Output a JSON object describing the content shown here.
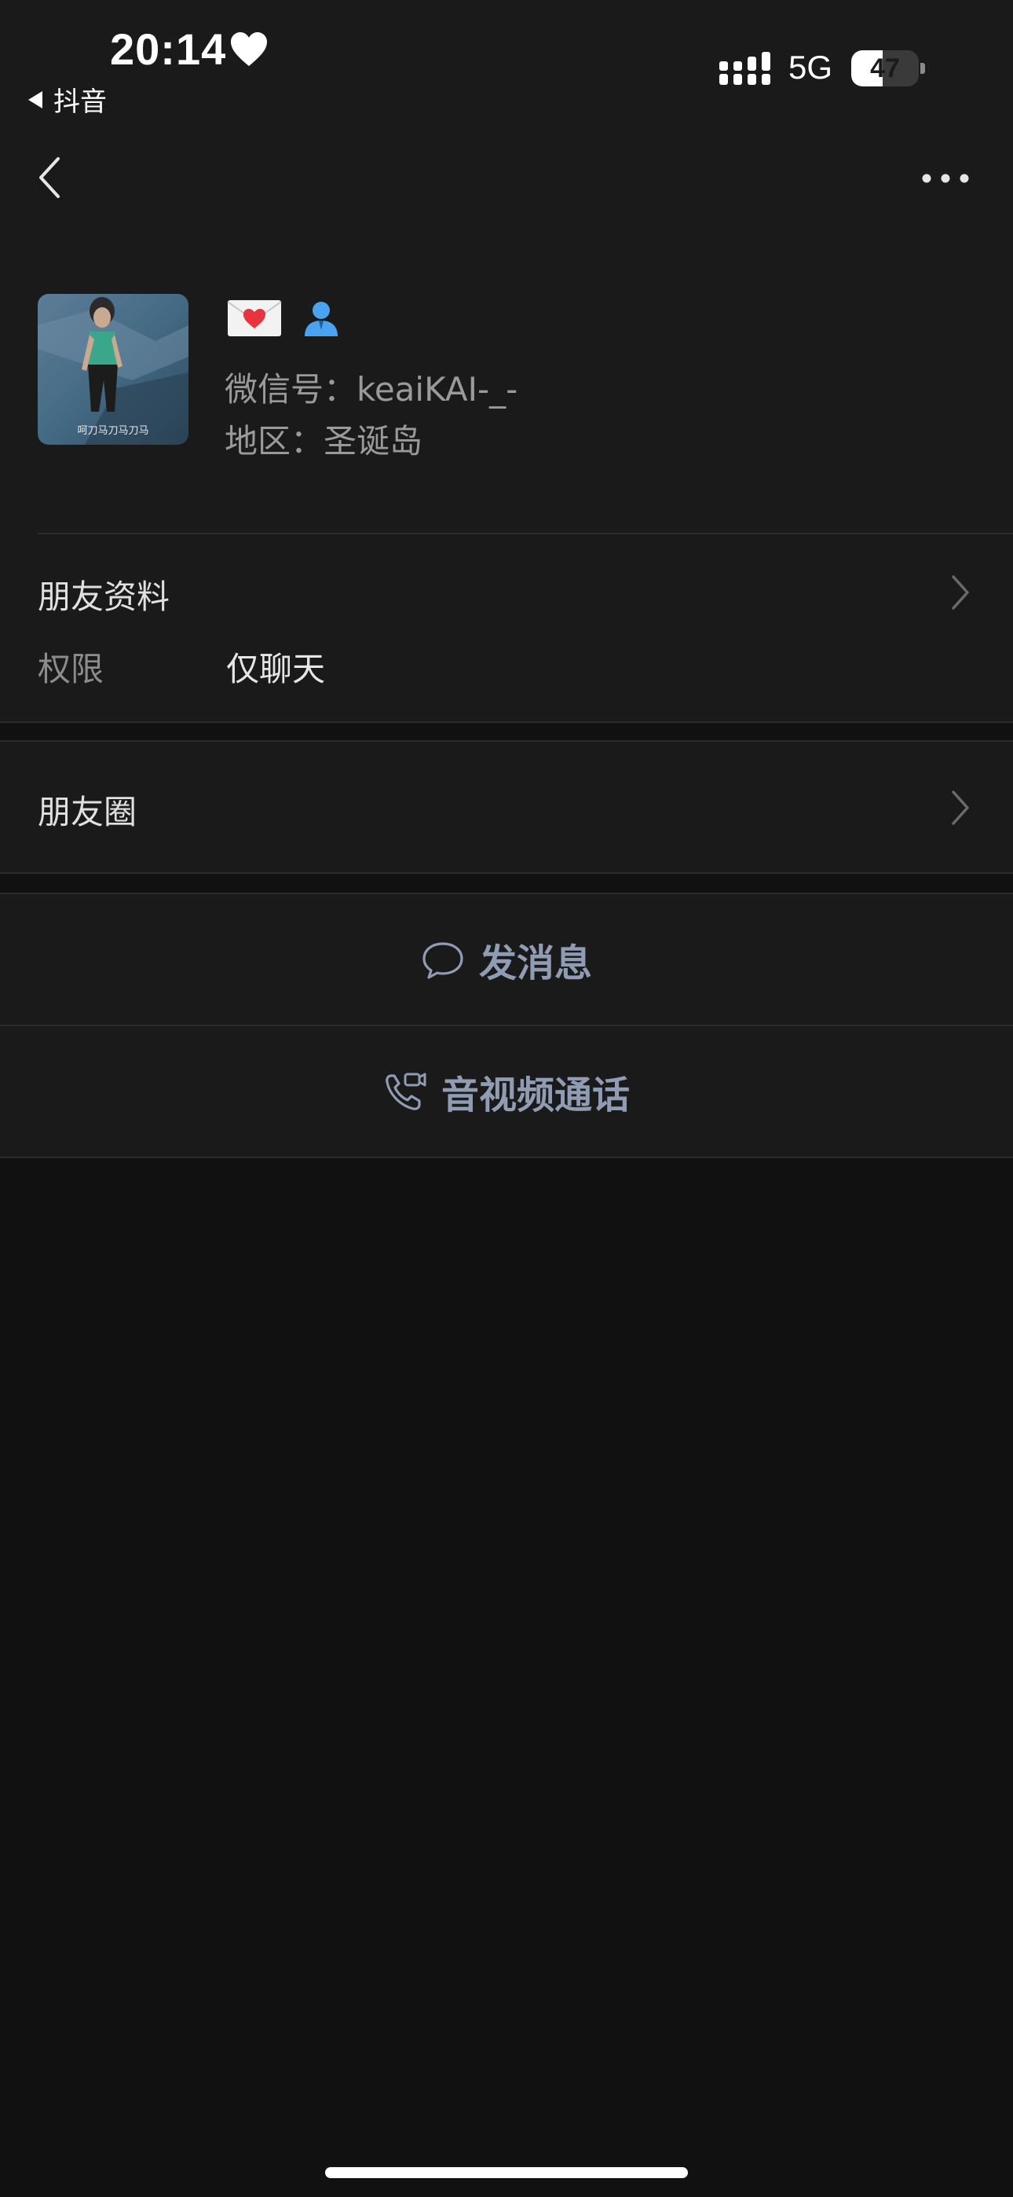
{
  "status_bar": {
    "time": "20:14",
    "back_app": "抖音",
    "network": "5G",
    "battery": "47",
    "battery_level": 0.47
  },
  "profile": {
    "wechat_id_label": "微信号：",
    "wechat_id": "keaiKAI-_-",
    "region_label": "地区：",
    "region": "圣诞岛",
    "avatar_caption": "呵刀马刀马刀马"
  },
  "sections": {
    "friend_info": "朋友资料",
    "permission_label": "权限",
    "permission_value": "仅聊天",
    "moments": "朋友圈"
  },
  "actions": {
    "send_message": "发消息",
    "video_call": "音视频通话"
  },
  "colors": {
    "background": "#111111",
    "panel": "#1a1a1a",
    "action_text": "#8f9cb3",
    "heart": "#e8343f",
    "badge_user": "#4aa3f0"
  },
  "icons": [
    "heart-icon",
    "back-arrow-icon",
    "more-icon",
    "mail-heart-icon",
    "user-icon",
    "chevron-right-icon",
    "chat-bubble-icon",
    "video-call-icon"
  ]
}
